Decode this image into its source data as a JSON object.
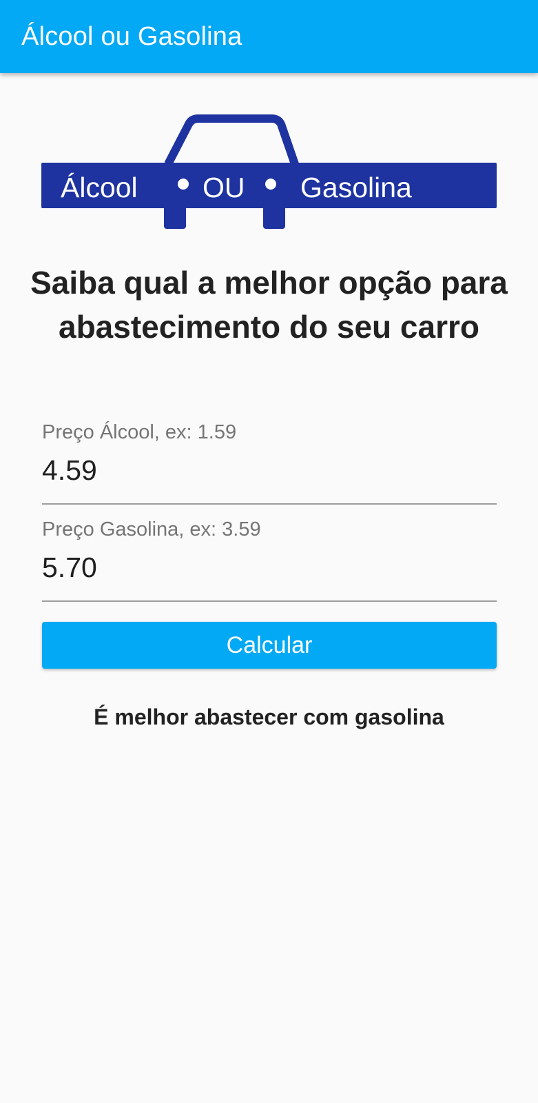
{
  "appbar": {
    "title": "Álcool ou Gasolina"
  },
  "logo": {
    "text_left": "Álcool",
    "text_middle": "OU",
    "text_right": "Gasolina",
    "color": "#1e33a0"
  },
  "headline": "Saiba qual a melhor opção para abastecimento do seu carro",
  "form": {
    "alcool": {
      "label": "Preço Álcool, ex: 1.59",
      "value": "4.59"
    },
    "gasolina": {
      "label": "Preço Gasolina, ex: 3.59",
      "value": "5.70"
    },
    "calculate_label": "Calcular"
  },
  "result": "É melhor abastecer com gasolina",
  "colors": {
    "primary": "#03a9f4",
    "background": "#fafafa",
    "text": "#222222",
    "hint": "#757575"
  }
}
